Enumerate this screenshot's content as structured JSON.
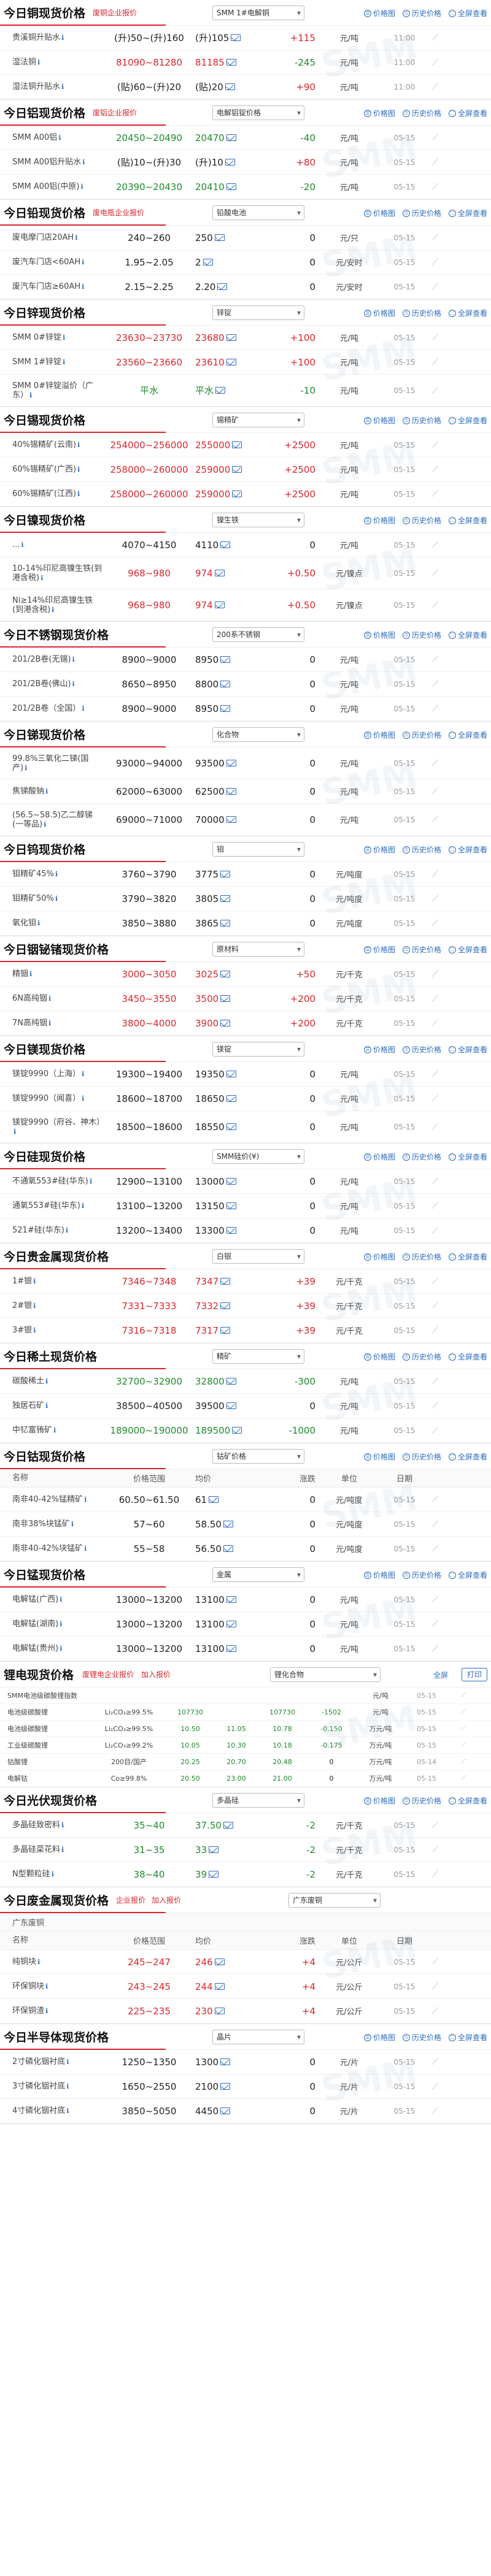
{
  "actions": {
    "price_chart": "价格图",
    "history": "历史价格",
    "full_view": "全屏查看"
  },
  "trend_icon": "trend-chart-icon",
  "sections": [
    {
      "id": "copper",
      "title": "今日铜现货价格",
      "tag": "废铜企业报价",
      "select": "SMM 1#电解铜",
      "rows": [
        {
          "name": "贵溪铜升贴水",
          "range": "(升)50~(升)160",
          "avg": "(升)105",
          "chg": "+115",
          "chg_color": "red",
          "unit": "元/吨",
          "date": "11:00"
        },
        {
          "name": "湿法铜",
          "range": "81090~81280",
          "avg": "81185",
          "chg": "-245",
          "chg_color": "green",
          "range_color": "red",
          "avg_color": "red",
          "unit": "元/吨",
          "date": "11:00"
        },
        {
          "name": "湿法铜升贴水",
          "range": "(贴)60~(升)20",
          "avg": "(贴)20",
          "chg": "+90",
          "chg_color": "red",
          "unit": "元/吨",
          "date": "11:00"
        }
      ]
    },
    {
      "id": "aluminum",
      "title": "今日铝现货价格",
      "tag": "废铝企业报价",
      "select": "电解铝锭价格",
      "rows": [
        {
          "name": "SMM A00铝",
          "range": "20450~20490",
          "avg": "20470",
          "chg": "-40",
          "chg_color": "green",
          "range_color": "green",
          "avg_color": "green",
          "unit": "元/吨",
          "date": "05-15"
        },
        {
          "name": "SMM A00铝升贴水",
          "range": "(贴)10~(升)30",
          "avg": "(升)10",
          "chg": "+80",
          "chg_color": "red",
          "unit": "元/吨",
          "date": "05-15"
        },
        {
          "name": "SMM A00铝(中原)",
          "range": "20390~20430",
          "avg": "20410",
          "chg": "-20",
          "chg_color": "green",
          "range_color": "green",
          "avg_color": "green",
          "unit": "元/吨",
          "date": "05-15"
        }
      ]
    },
    {
      "id": "lead",
      "title": "今日铅现货价格",
      "tag": "废电瓶企业报价",
      "select": "铅酸电池",
      "rows": [
        {
          "name": "废电摩门店20AH",
          "range": "240~260",
          "avg": "250",
          "chg": "0",
          "chg_color": "black",
          "unit": "元/只",
          "date": "05-15"
        },
        {
          "name": "废汽车门店<60AH",
          "range": "1.95~2.05",
          "avg": "2",
          "chg": "0",
          "chg_color": "black",
          "unit": "元/安时",
          "date": "05-15"
        },
        {
          "name": "废汽车门店≥60AH",
          "range": "2.15~2.25",
          "avg": "2.20",
          "chg": "0",
          "chg_color": "black",
          "unit": "元/安时",
          "date": "05-15"
        }
      ]
    },
    {
      "id": "zinc",
      "title": "今日锌现货价格",
      "tag": "",
      "select": "锌锭",
      "rows": [
        {
          "name": "SMM 0#锌锭",
          "range": "23630~23730",
          "avg": "23680",
          "chg": "+100",
          "chg_color": "red",
          "range_color": "red",
          "avg_color": "red",
          "unit": "元/吨",
          "date": "05-15"
        },
        {
          "name": "SMM 1#锌锭",
          "range": "23560~23660",
          "avg": "23610",
          "chg": "+100",
          "chg_color": "red",
          "range_color": "red",
          "avg_color": "red",
          "unit": "元/吨",
          "date": "05-15"
        },
        {
          "name": "SMM 0#锌锭溢价（广东）",
          "range": "平水",
          "avg": "平水",
          "chg": "-10",
          "chg_color": "green",
          "range_color": "green",
          "avg_color": "green",
          "unit": "元/吨",
          "date": "05-15",
          "tall": true
        }
      ]
    },
    {
      "id": "tin",
      "title": "今日锡现货价格",
      "tag": "",
      "select": "锡精矿",
      "rows": [
        {
          "name": "40%锡精矿(云南)",
          "range": "254000~256000",
          "avg": "255000",
          "chg": "+2500",
          "chg_color": "red",
          "range_color": "red",
          "avg_color": "red",
          "unit": "元/吨",
          "date": "05-15"
        },
        {
          "name": "60%锡精矿(广西)",
          "range": "258000~260000",
          "avg": "259000",
          "chg": "+2500",
          "chg_color": "red",
          "range_color": "red",
          "avg_color": "red",
          "unit": "元/吨",
          "date": "05-15"
        },
        {
          "name": "60%锡精矿(江西)",
          "range": "258000~260000",
          "avg": "259000",
          "chg": "+2500",
          "chg_color": "red",
          "range_color": "red",
          "avg_color": "red",
          "unit": "元/吨",
          "date": "05-15"
        }
      ]
    },
    {
      "id": "nickel",
      "title": "今日镍现货价格",
      "tag": "",
      "select": "镍生铁",
      "rows": [
        {
          "name": "...",
          "range": "4070~4150",
          "avg": "4110",
          "chg": "0",
          "chg_color": "black",
          "unit": "元/吨",
          "date": "05-15"
        },
        {
          "name": "10-14%印尼高镍生铁(到港含税)",
          "range": "968~980",
          "avg": "974",
          "chg": "+0.50",
          "chg_color": "red",
          "range_color": "red",
          "avg_color": "red",
          "unit": "元/镍点",
          "date": "05-15",
          "tall": true
        },
        {
          "name": "Ni≥14%印尼高镍生铁(到港含税)",
          "range": "968~980",
          "avg": "974",
          "chg": "+0.50",
          "chg_color": "red",
          "range_color": "red",
          "avg_color": "red",
          "unit": "元/镍点",
          "date": "05-15",
          "tall": true
        }
      ]
    },
    {
      "id": "stainless",
      "title": "今日不锈钢现货价格",
      "tag": "",
      "select": "200系不锈钢",
      "rows": [
        {
          "name": "201/2B卷(无锡)",
          "range": "8900~9000",
          "avg": "8950",
          "chg": "0",
          "chg_color": "black",
          "unit": "元/吨",
          "date": "05-15"
        },
        {
          "name": "201/2B卷(佛山)",
          "range": "8650~8950",
          "avg": "8800",
          "chg": "0",
          "chg_color": "black",
          "unit": "元/吨",
          "date": "05-15"
        },
        {
          "name": "201/2B卷（全国）",
          "range": "8900~9000",
          "avg": "8950",
          "chg": "0",
          "chg_color": "black",
          "unit": "元/吨",
          "date": "05-15"
        }
      ]
    },
    {
      "id": "antimony",
      "title": "今日锑现货价格",
      "tag": "",
      "select": "化合物",
      "rows": [
        {
          "name": "99.8%三氧化二锑(国产)",
          "range": "93000~94000",
          "avg": "93500",
          "chg": "0",
          "chg_color": "black",
          "unit": "元/吨",
          "date": "05-15",
          "tall": true
        },
        {
          "name": "焦锑酸钠",
          "range": "62000~63000",
          "avg": "62500",
          "chg": "0",
          "chg_color": "black",
          "unit": "元/吨",
          "date": "05-15"
        },
        {
          "name": "(56.5~58.5)乙二醇锑(一等品)",
          "range": "69000~71000",
          "avg": "70000",
          "chg": "0",
          "chg_color": "black",
          "unit": "元/吨",
          "date": "05-15",
          "tall": true
        }
      ]
    },
    {
      "id": "tungsten",
      "title": "今日钨现货价格",
      "tag": "",
      "select": "钼",
      "rows": [
        {
          "name": "钼精矿45%",
          "range": "3760~3790",
          "avg": "3775",
          "chg": "0",
          "chg_color": "black",
          "unit": "元/吨度",
          "date": "05-15"
        },
        {
          "name": "钼精矿50%",
          "range": "3790~3820",
          "avg": "3805",
          "chg": "0",
          "chg_color": "black",
          "unit": "元/吨度",
          "date": "05-15"
        },
        {
          "name": "氧化钼",
          "range": "3850~3880",
          "avg": "3865",
          "chg": "0",
          "chg_color": "black",
          "unit": "元/吨度",
          "date": "05-15"
        }
      ]
    },
    {
      "id": "indium",
      "title": "今日铟铋锗现货价格",
      "tag": "",
      "select": "原材料",
      "rows": [
        {
          "name": "精铟",
          "range": "3000~3050",
          "avg": "3025",
          "chg": "+50",
          "chg_color": "red",
          "range_color": "red",
          "avg_color": "red",
          "unit": "元/千克",
          "date": "05-15"
        },
        {
          "name": "6N高纯铟",
          "range": "3450~3550",
          "avg": "3500",
          "chg": "+200",
          "chg_color": "red",
          "range_color": "red",
          "avg_color": "red",
          "unit": "元/千克",
          "date": "05-15"
        },
        {
          "name": "7N高纯铟",
          "range": "3800~4000",
          "avg": "3900",
          "chg": "+200",
          "chg_color": "red",
          "range_color": "red",
          "avg_color": "red",
          "unit": "元/千克",
          "date": "05-15"
        }
      ]
    },
    {
      "id": "magnesium",
      "title": "今日镁现货价格",
      "tag": "",
      "select": "镁锭",
      "rows": [
        {
          "name": "镁锭9990（上海）",
          "range": "19300~19400",
          "avg": "19350",
          "chg": "0",
          "chg_color": "black",
          "unit": "元/吨",
          "date": "05-15"
        },
        {
          "name": "镁锭9990（闻喜）",
          "range": "18600~18700",
          "avg": "18650",
          "chg": "0",
          "chg_color": "black",
          "unit": "元/吨",
          "date": "05-15"
        },
        {
          "name": "镁锭9990（府谷、神木）",
          "range": "18500~18600",
          "avg": "18550",
          "chg": "0",
          "chg_color": "black",
          "unit": "元/吨",
          "date": "05-15",
          "tall": true
        }
      ]
    },
    {
      "id": "silicon",
      "title": "今日硅现货价格",
      "tag": "",
      "select": "SMM硅价(¥)",
      "rows": [
        {
          "name": "不通氧553#硅(华东)",
          "range": "12900~13100",
          "avg": "13000",
          "chg": "0",
          "chg_color": "black",
          "unit": "元/吨",
          "date": "05-15"
        },
        {
          "name": "通氧553#硅(华东)",
          "range": "13100~13200",
          "avg": "13150",
          "chg": "0",
          "chg_color": "black",
          "unit": "元/吨",
          "date": "05-15"
        },
        {
          "name": "521#硅(华东)",
          "range": "13200~13400",
          "avg": "13300",
          "chg": "0",
          "chg_color": "black",
          "unit": "元/吨",
          "date": "05-15"
        }
      ]
    },
    {
      "id": "precious",
      "title": "今日贵金属现货价格",
      "tag": "",
      "select": "白银",
      "rows": [
        {
          "name": "1#银",
          "range": "7346~7348",
          "avg": "7347",
          "chg": "+39",
          "chg_color": "red",
          "range_color": "red",
          "avg_color": "red",
          "unit": "元/千克",
          "date": "05-15"
        },
        {
          "name": "2#银",
          "range": "7331~7333",
          "avg": "7332",
          "chg": "+39",
          "chg_color": "red",
          "range_color": "red",
          "avg_color": "red",
          "unit": "元/千克",
          "date": "05-15"
        },
        {
          "name": "3#银",
          "range": "7316~7318",
          "avg": "7317",
          "chg": "+39",
          "chg_color": "red",
          "range_color": "red",
          "avg_color": "red",
          "unit": "元/千克",
          "date": "05-15"
        }
      ]
    },
    {
      "id": "rare_earth",
      "title": "今日稀土现货价格",
      "tag": "",
      "select": "精矿",
      "rows": [
        {
          "name": "碳酸稀土",
          "range": "32700~32900",
          "avg": "32800",
          "chg": "-300",
          "chg_color": "green",
          "range_color": "green",
          "avg_color": "green",
          "unit": "元/吨",
          "date": "05-15"
        },
        {
          "name": "独居石矿",
          "range": "38500~40500",
          "avg": "39500",
          "chg": "0",
          "chg_color": "black",
          "unit": "元/吨",
          "date": "05-15"
        },
        {
          "name": "中钇富铕矿",
          "range": "189000~190000",
          "avg": "189500",
          "chg": "-1000",
          "chg_color": "green",
          "range_color": "green",
          "avg_color": "green",
          "unit": "元/吨",
          "date": "05-15"
        }
      ]
    },
    {
      "id": "cobalt",
      "title": "今日钴现货价格",
      "tag": "",
      "select": "钴矿价格",
      "columns": [
        "名称",
        "价格范围",
        "均价",
        "涨跌",
        "单位",
        "日期"
      ],
      "rows": [
        {
          "name": "南非40-42%锰精矿",
          "range": "60.50~61.50",
          "avg": "61",
          "chg": "0",
          "chg_color": "black",
          "unit": "元/吨度",
          "date": "05-15"
        },
        {
          "name": "南非38%块锰矿",
          "range": "57~60",
          "avg": "58.50",
          "chg": "0",
          "chg_color": "black",
          "unit": "元/吨度",
          "date": "05-15"
        },
        {
          "name": "南非40-42%块锰矿",
          "range": "55~58",
          "avg": "56.50",
          "chg": "0",
          "chg_color": "black",
          "unit": "元/吨度",
          "date": "05-15"
        }
      ]
    },
    {
      "id": "manganese",
      "title": "今日锰现货价格",
      "tag": "",
      "select": "金属",
      "rows": [
        {
          "name": "电解锰(广西)",
          "range": "13000~13200",
          "avg": "13100",
          "chg": "0",
          "chg_color": "black",
          "unit": "元/吨",
          "date": "05-15"
        },
        {
          "name": "电解锰(湖南)",
          "range": "13000~13200",
          "avg": "13100",
          "chg": "0",
          "chg_color": "black",
          "unit": "元/吨",
          "date": "05-15"
        },
        {
          "name": "电解锰(贵州)",
          "range": "13000~13200",
          "avg": "13100",
          "chg": "0",
          "chg_color": "black",
          "unit": "元/吨",
          "date": "05-15"
        }
      ]
    }
  ],
  "lithium": {
    "title": "锂电现货价格",
    "tabs": [
      "废锂电企业报价",
      "加入报价"
    ],
    "select": "锂化合物",
    "full": "全屏",
    "print": "打印",
    "rows": [
      {
        "name": "SMM电池级碳酸锂指数",
        "spec": "",
        "low": "",
        "mid": "",
        "avg": "",
        "chg": "",
        "chg_color": "black",
        "unit": "元/吨",
        "date": "05-15"
      },
      {
        "name": "电池级碳酸锂",
        "spec": "Li₂CO₃≥99.5%",
        "low": "107730",
        "mid": "",
        "avg": "107730",
        "chg": "-1502",
        "chg_color": "green",
        "unit": "元/吨",
        "date": "05-15"
      },
      {
        "name": "电池级碳酸锂",
        "spec": "Li₂CO₃≥99.5%",
        "low": "10.50",
        "mid": "11.05",
        "avg": "10.78",
        "chg": "-0.150",
        "chg_color": "green",
        "unit": "万元/吨",
        "date": "05-15"
      },
      {
        "name": "工业级碳酸锂",
        "spec": "Li₂CO₃≥99.2%",
        "low": "10.05",
        "mid": "10.30",
        "avg": "10.18",
        "chg": "-0.175",
        "chg_color": "green",
        "unit": "万元/吨",
        "date": "05-15"
      },
      {
        "name": "钴酸锂",
        "spec": "200目/国产",
        "low": "20.25",
        "mid": "20.70",
        "avg": "20.48",
        "chg": "0",
        "chg_color": "black",
        "unit": "万元/吨",
        "date": "05-14"
      },
      {
        "name": "电解钴",
        "spec": "Co≥99.8%",
        "low": "20.50",
        "mid": "23.00",
        "avg": "21.00",
        "chg": "0",
        "chg_color": "black",
        "unit": "万元/吨",
        "date": "05-15"
      }
    ]
  },
  "pv": {
    "title": "今日光伏现货价格",
    "tag": "",
    "select": "多晶硅",
    "rows": [
      {
        "name": "多晶硅致密料",
        "range": "35~40",
        "avg": "37.50",
        "chg": "-2",
        "chg_color": "green",
        "range_color": "green",
        "avg_color": "green",
        "unit": "元/千克",
        "date": "05-15"
      },
      {
        "name": "多晶硅菜花料",
        "range": "31~35",
        "avg": "33",
        "chg": "-2",
        "chg_color": "green",
        "range_color": "green",
        "avg_color": "green",
        "unit": "元/千克",
        "date": "05-15"
      },
      {
        "name": "N型颗粒硅",
        "range": "38~40",
        "avg": "39",
        "chg": "-2",
        "chg_color": "green",
        "range_color": "green",
        "avg_color": "green",
        "unit": "元/千克",
        "date": "05-15"
      }
    ]
  },
  "scrap": {
    "title": "今日废金属现货价格",
    "tags": [
      "企业报价",
      "加入报价"
    ],
    "select": "广东废铜",
    "region": "广东废铜",
    "columns": [
      "名称",
      "价格范围",
      "均价",
      "涨跌",
      "单位",
      "日期"
    ],
    "rows": [
      {
        "name": "纯铜块",
        "range": "245~247",
        "avg": "246",
        "chg": "+4",
        "chg_color": "red",
        "range_color": "red",
        "avg_color": "red",
        "unit": "元/公斤",
        "date": "05-15"
      },
      {
        "name": "环保铜块",
        "range": "243~245",
        "avg": "244",
        "chg": "+4",
        "chg_color": "red",
        "range_color": "red",
        "avg_color": "red",
        "unit": "元/公斤",
        "date": "05-15"
      },
      {
        "name": "环保铜渣",
        "range": "225~235",
        "avg": "230",
        "chg": "+4",
        "chg_color": "red",
        "range_color": "red",
        "avg_color": "red",
        "unit": "元/公斤",
        "date": "05-15"
      }
    ]
  },
  "semi": {
    "title": "今日半导体现货价格",
    "tag": "",
    "select": "晶片",
    "rows": [
      {
        "name": "2寸磷化铟衬底",
        "range": "1250~1350",
        "avg": "1300",
        "chg": "0",
        "chg_color": "black",
        "unit": "元/片",
        "date": "05-15"
      },
      {
        "name": "3寸磷化铟衬底",
        "range": "1650~2550",
        "avg": "2100",
        "chg": "0",
        "chg_color": "black",
        "unit": "元/片",
        "date": "05-15"
      },
      {
        "name": "4寸磷化铟衬底",
        "range": "3850~5050",
        "avg": "4450",
        "chg": "0",
        "chg_color": "black",
        "unit": "元/片",
        "date": "05-15"
      }
    ]
  }
}
